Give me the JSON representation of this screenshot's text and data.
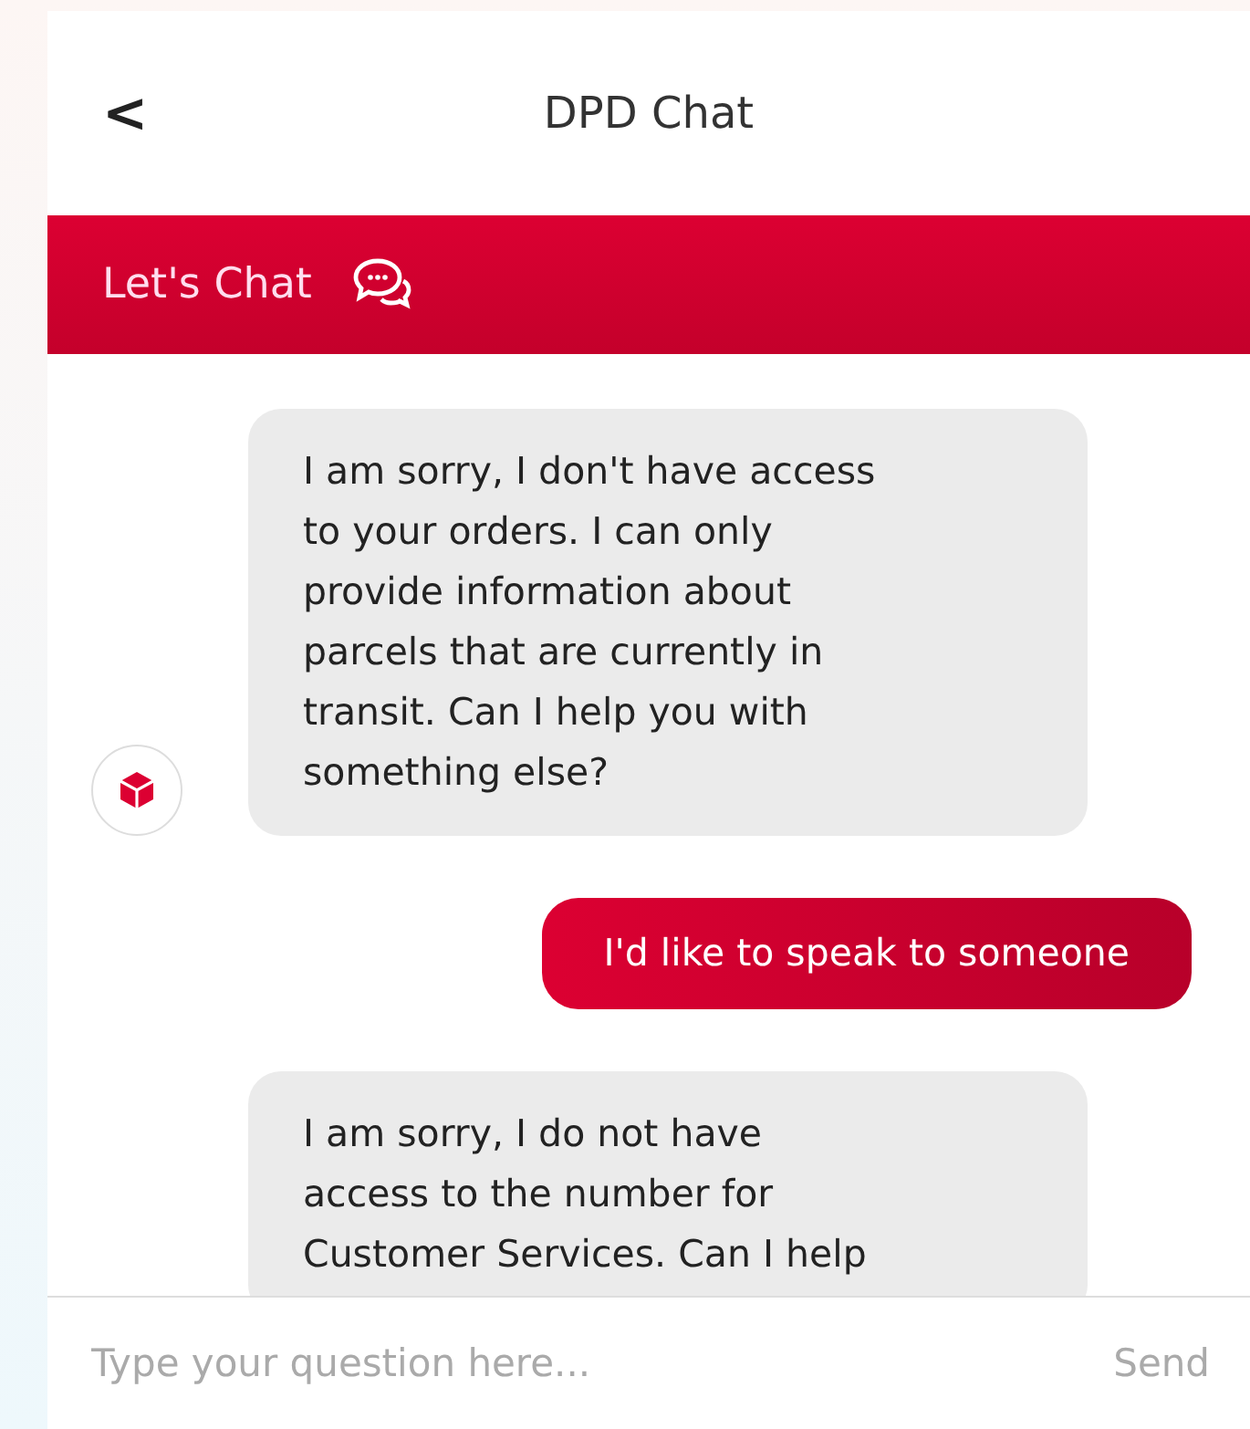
{
  "header": {
    "back": "<",
    "title": "DPD Chat"
  },
  "banner": {
    "title": "Let's Chat"
  },
  "messages": [
    {
      "kind": "bot",
      "lines": [
        "I am sorry, I don't have access",
        "to your orders. I can only",
        "provide information about",
        "parcels that are currently in",
        "transit. Can I help you with",
        "something else?"
      ],
      "avatar": true
    },
    {
      "kind": "user",
      "lines": [
        "I'd like to speak to someone"
      ]
    },
    {
      "kind": "bot",
      "lines": [
        "I am sorry, I do not have",
        "access to the number for",
        "Customer Services. Can I help"
      ],
      "avatar": false
    }
  ],
  "composer": {
    "placeholder": "Type your question here...",
    "send": "Send"
  }
}
